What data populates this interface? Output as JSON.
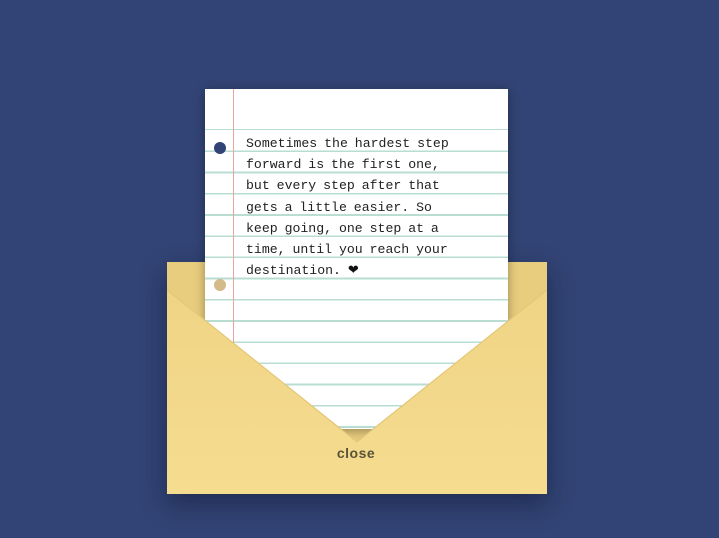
{
  "letter": {
    "lines": [
      "Sometimes the hardest step",
      "forward is the first one,",
      "but every step after that",
      "gets a little easier. So",
      "keep going, one step at a",
      "time, until you reach your",
      "destination."
    ],
    "heart_icon": "heart-icon",
    "heart_glyph": "❤"
  },
  "envelope": {
    "close_label": "close"
  },
  "colors": {
    "background": "#324475",
    "envelope": "#f4dc8f",
    "paper": "#ffffff",
    "rule_line": "#b9ddd3",
    "margin_line": "#e8a3a3"
  }
}
